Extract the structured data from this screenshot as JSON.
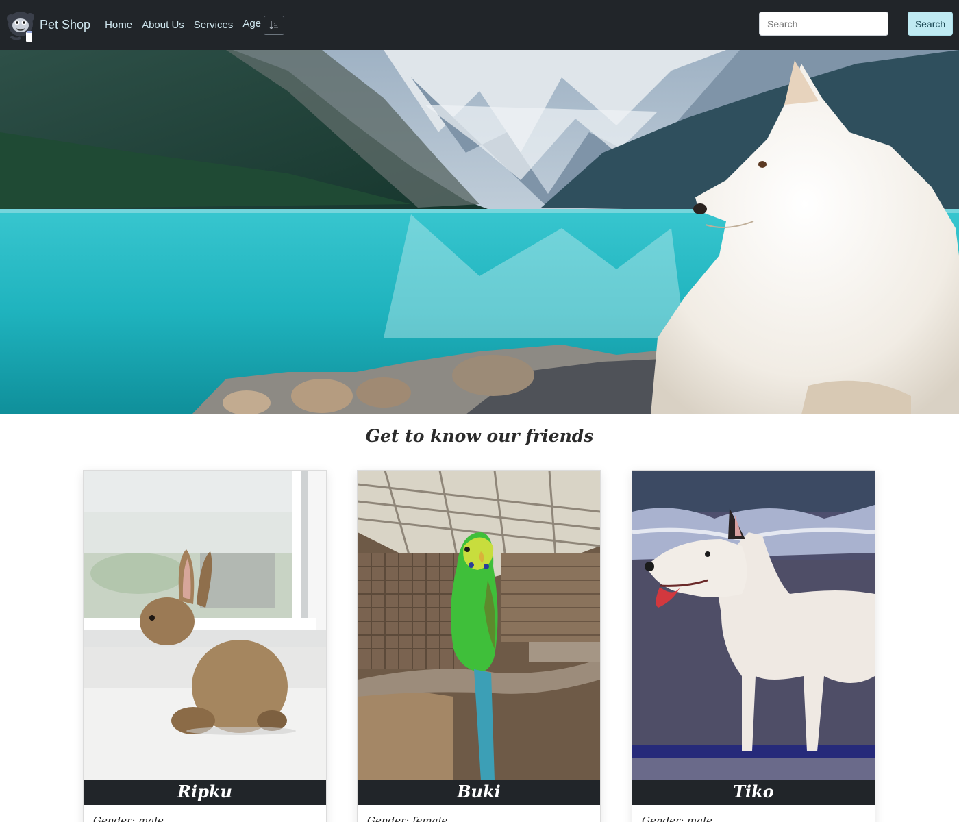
{
  "navbar": {
    "brand": "Pet Shop",
    "links": [
      "Home",
      "About Us",
      "Services"
    ],
    "age_label": "Age",
    "search_placeholder": "Search",
    "search_button": "Search"
  },
  "section": {
    "title": "Get to know our friends"
  },
  "pets": [
    {
      "name": "Ripku",
      "gender": "Gender: male"
    },
    {
      "name": "Buki",
      "gender": "Gender: female"
    },
    {
      "name": "Tiko",
      "gender": "Gender: male"
    }
  ],
  "colors": {
    "navbar": "#212529",
    "nav_text": "#cfe6ee",
    "search_button": "#bfeaf2",
    "card_title_bar": "#212529"
  },
  "icons": {
    "logo": "monkey-logo-icon",
    "sort": "sort-icon"
  }
}
